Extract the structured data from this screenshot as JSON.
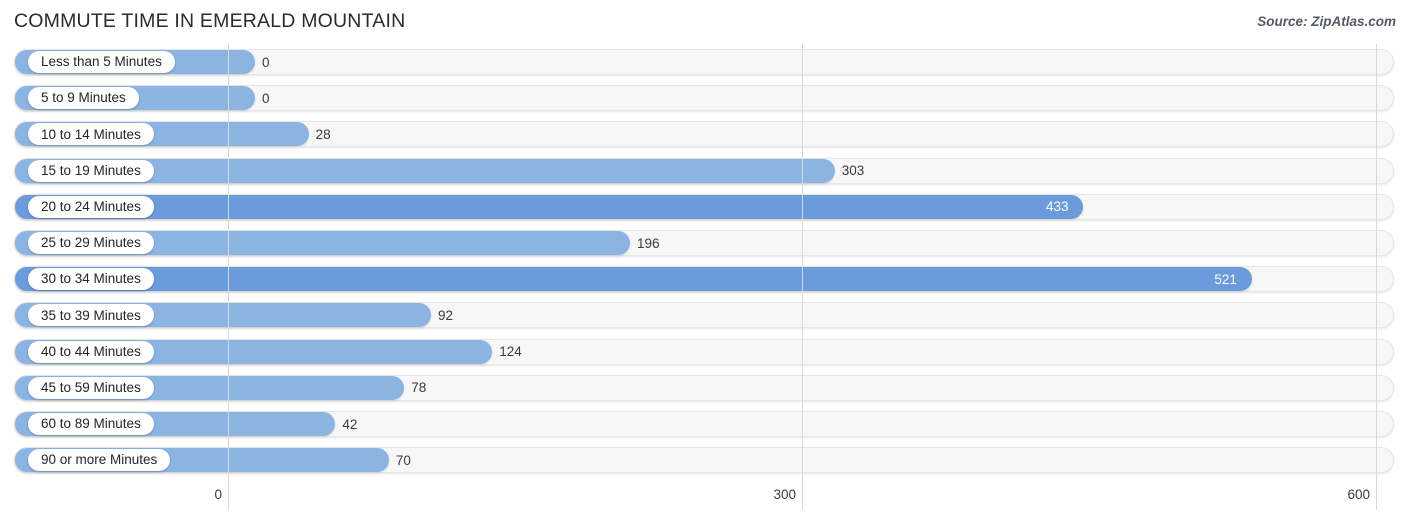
{
  "header": {
    "title": "COMMUTE TIME IN EMERALD MOUNTAIN",
    "source": "Source: ZipAtlas.com"
  },
  "colors": {
    "bar_light": "#8cb4e2",
    "bar_dark": "#6b9bda",
    "track": "#f7f7f7",
    "grid": "#d8d8d8",
    "label_text": "#24242a",
    "value_text": "#3a3a42",
    "value_text_inside": "#ffffff"
  },
  "chart_data": {
    "type": "bar",
    "orientation": "horizontal",
    "title": "COMMUTE TIME IN EMERALD MOUNTAIN",
    "xlabel": "",
    "ylabel": "",
    "xlim": [
      0,
      600
    ],
    "xticks": [
      0,
      300,
      600
    ],
    "xtick_labels": [
      "0",
      "300",
      "600"
    ],
    "grid": true,
    "legend": false,
    "categories": [
      "Less than 5 Minutes",
      "5 to 9 Minutes",
      "10 to 14 Minutes",
      "15 to 19 Minutes",
      "20 to 24 Minutes",
      "25 to 29 Minutes",
      "30 to 34 Minutes",
      "35 to 39 Minutes",
      "40 to 44 Minutes",
      "45 to 59 Minutes",
      "60 to 89 Minutes",
      "90 or more Minutes"
    ],
    "values": [
      0,
      0,
      28,
      303,
      433,
      196,
      521,
      92,
      124,
      78,
      42,
      70
    ],
    "value_labels": [
      "0",
      "0",
      "28",
      "303",
      "433",
      "196",
      "521",
      "92",
      "124",
      "78",
      "42",
      "70"
    ]
  }
}
